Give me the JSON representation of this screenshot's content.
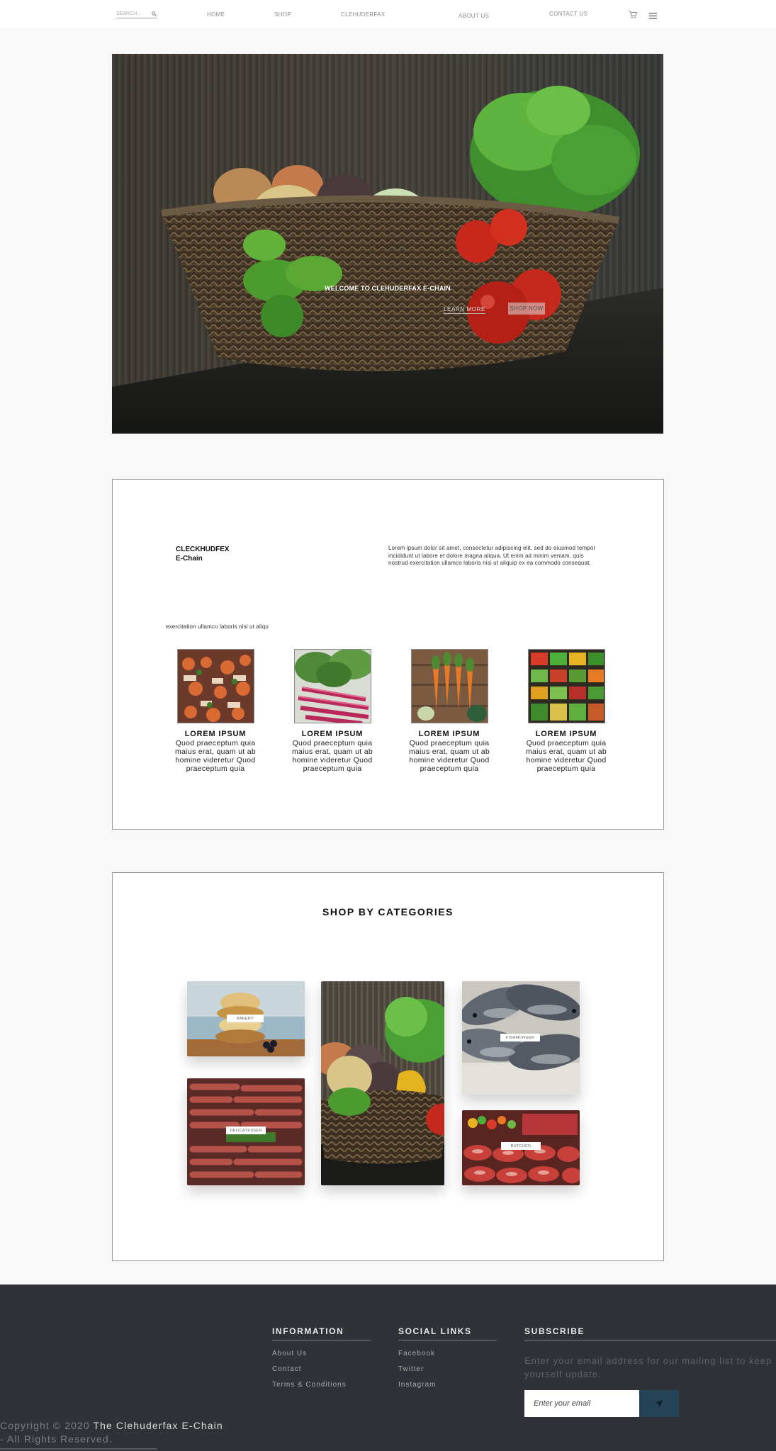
{
  "nav": {
    "search_placeholder": "SEARCH...",
    "links": [
      "HOME",
      "SHOP",
      "CLEHUDERFAX",
      "ABOUT US",
      "CONTACT US"
    ],
    "icons": [
      "search-icon",
      "cart-icon",
      "hamburger-menu-icon"
    ]
  },
  "hero": {
    "title": "WELCOME TO CLEHUDERFAX E-CHAIN",
    "learn_more": "LEARN MORE",
    "shop_now": "SHOP NOW"
  },
  "about": {
    "brand_line1": "CLECKHUDFEX",
    "brand_line2": "E-Chain",
    "description": "Lorem ipsum dolor sit amet, consectetur adipiscing elit, sed do eiusmod tempor incididunt ut labore et dolore magna aliqua. Ut enim ad minim veniam, quis nostrud exercitation ullamco laboris nisi ut aliquip ex ea commodo consequat.",
    "subline": "exercitation ullamco laboris nisi ut aliqu",
    "cards": [
      {
        "name": "LOREM IPSUM",
        "text": "Quod praeceptum quia maius erat, quam ut ab homine videretur Quod praeceptum quia"
      },
      {
        "name": "LOREM IPSUM",
        "text": "Quod praeceptum quia maius erat, quam ut ab homine videretur Quod praeceptum quia"
      },
      {
        "name": "LOREM IPSUM",
        "text": "Quod praeceptum quia maius erat, quam ut ab homine videretur Quod praeceptum quia"
      },
      {
        "name": "LOREM IPSUM",
        "text": "Quod praeceptum quia maius erat, quam ut ab homine videretur Quod praeceptum quia"
      }
    ]
  },
  "categories": {
    "heading": "SHOP BY CATEGORIES",
    "labels": {
      "bakery": "BAKERY",
      "delicatessen": "DELICATESSEN",
      "fishmonger": "FISHMONGER",
      "butcher": "BUTCHER"
    }
  },
  "footer": {
    "information": {
      "title": "INFORMATION",
      "links": [
        "About Us",
        "Contact",
        "Terms & Conditions"
      ]
    },
    "social": {
      "title": "SOCIAL LINKS",
      "links": [
        "Facebook",
        "Twitter",
        "Instagram"
      ]
    },
    "subscribe": {
      "title": "SUBSCRIBE",
      "text": "Enter your email address for our mailing list to keep yourself update.",
      "placeholder": "Enter your email",
      "button_icon": "send-icon"
    },
    "copyright_prefix": "Copyright © 2020 ",
    "copyright_brand": "The Clehuderfax E-Chain",
    "rights": "- All Rights Reserved."
  },
  "colors": {
    "page_bg": "#f8f8f8",
    "footer_bg": "#2f3236",
    "subscribe_button": "#254256"
  }
}
